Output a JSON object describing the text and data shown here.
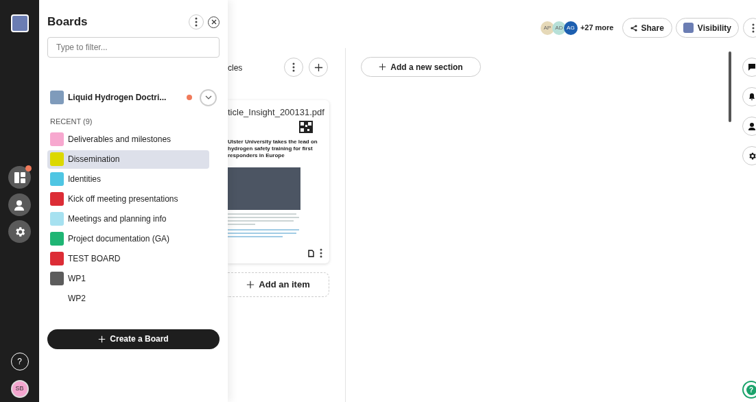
{
  "rail": {
    "avatar": "SB",
    "boards_badge": true,
    "help": "?"
  },
  "help_button": "?",
  "panel": {
    "title": "Boards",
    "filter": {
      "placeholder": "Type to filter..."
    },
    "current": {
      "name": "Liquid Hydrogen Doctri...",
      "color": "#7f9bbb",
      "unread": true
    },
    "recent_label": "RECENT (9)",
    "boards": [
      {
        "name": "Deliverables and milestones",
        "color": "#f7a8cf",
        "selected": false
      },
      {
        "name": "Dissemination",
        "color": "#dcd800",
        "selected": true
      },
      {
        "name": "Identities",
        "color": "#4fc6e3",
        "selected": false
      },
      {
        "name": "Kick off meeting presentations",
        "color": "#dc2d36",
        "selected": false
      },
      {
        "name": "Meetings and planning info",
        "color": "#a6e1f0",
        "selected": false
      },
      {
        "name": "Project documentation (GA)",
        "color": "#1fb574",
        "selected": false
      },
      {
        "name": "TEST BOARD",
        "color": "#dc2d36",
        "selected": false
      },
      {
        "name": "WP1",
        "color": "#5c5c5c",
        "selected": false
      },
      {
        "name": "WP2",
        "selected": false
      }
    ],
    "create_button": "Create a Board"
  },
  "header": {
    "members": [
      {
        "initials": "AP",
        "color": "#e6d9b8"
      },
      {
        "initials": "AD",
        "color": "#b7e0d8"
      },
      {
        "initials": "AG",
        "color": "#1d5fb0"
      }
    ],
    "more": "+27 more",
    "share": "Share",
    "visibility": "Visibility"
  },
  "section": {
    "title": "cles",
    "card": {
      "filename": "ticle_Insight_200131.pdf",
      "headline": "Ulster University takes the lead on hydrogen safety training for first responders in Europe"
    },
    "add_item": "Add an item"
  },
  "add_section": "Add a new section"
}
